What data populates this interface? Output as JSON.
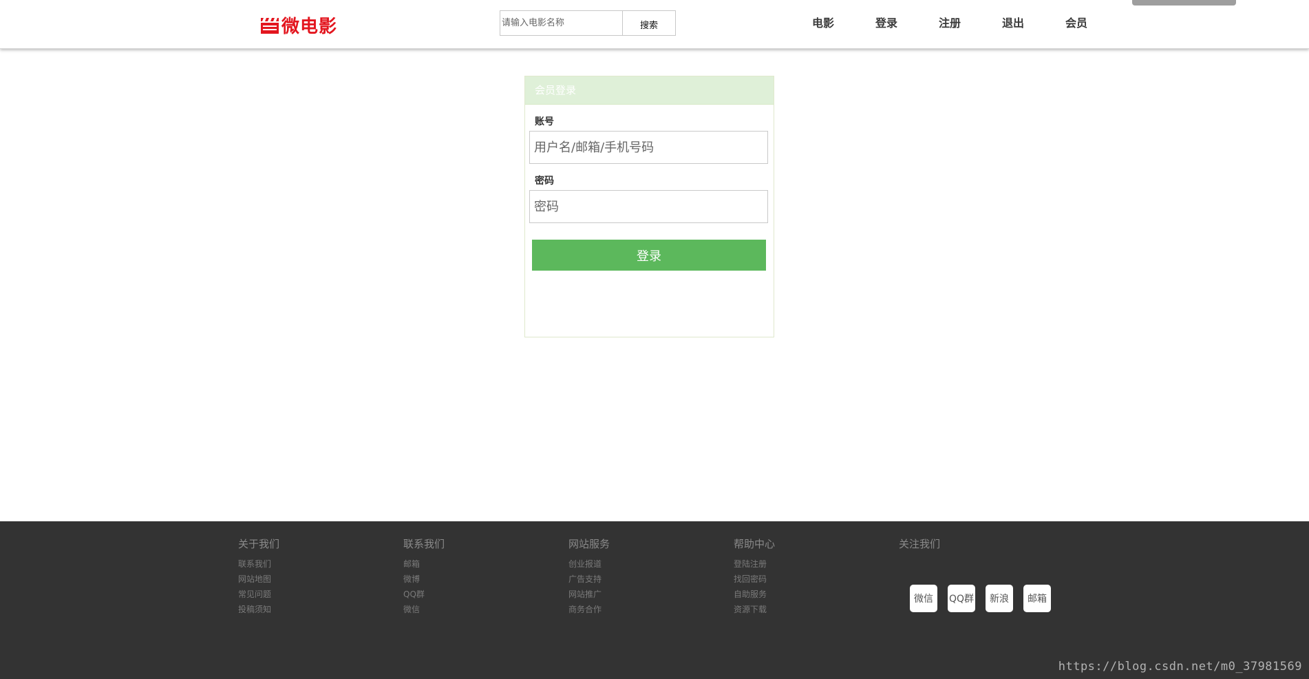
{
  "header": {
    "logo_text": "微电影",
    "search": {
      "placeholder": "请输入电影名称",
      "button_label": "搜索"
    },
    "nav": [
      "电影",
      "登录",
      "注册",
      "退出",
      "会员"
    ]
  },
  "login": {
    "heading": "会员登录",
    "account_label": "账号",
    "account_placeholder": "用户名/邮箱/手机号码",
    "password_label": "密码",
    "password_placeholder": "密码",
    "submit_label": "登录"
  },
  "footer": {
    "columns": [
      {
        "title": "关于我们",
        "links": [
          "联系我们",
          "网站地图",
          "常见问题",
          "投稿须知"
        ]
      },
      {
        "title": "联系我们",
        "links": [
          "邮箱",
          "微博",
          "QQ群",
          "微信"
        ]
      },
      {
        "title": "网站服务",
        "links": [
          "创业报道",
          "广告支持",
          "网站推广",
          "商务合作"
        ]
      },
      {
        "title": "帮助中心",
        "links": [
          "登陆注册",
          "找回密码",
          "自助服务",
          "资源下载"
        ]
      }
    ],
    "follow": {
      "title": "关注我们",
      "items": [
        "微信",
        "QQ群",
        "新浪",
        "邮箱"
      ]
    },
    "watermark": "https://blog.csdn.net/m0_37981569"
  },
  "colors": {
    "brand_red": "#e3161f",
    "login_green": "#5cb85c",
    "panel_heading_bg": "#dff0d8",
    "footer_bg": "#333333"
  }
}
